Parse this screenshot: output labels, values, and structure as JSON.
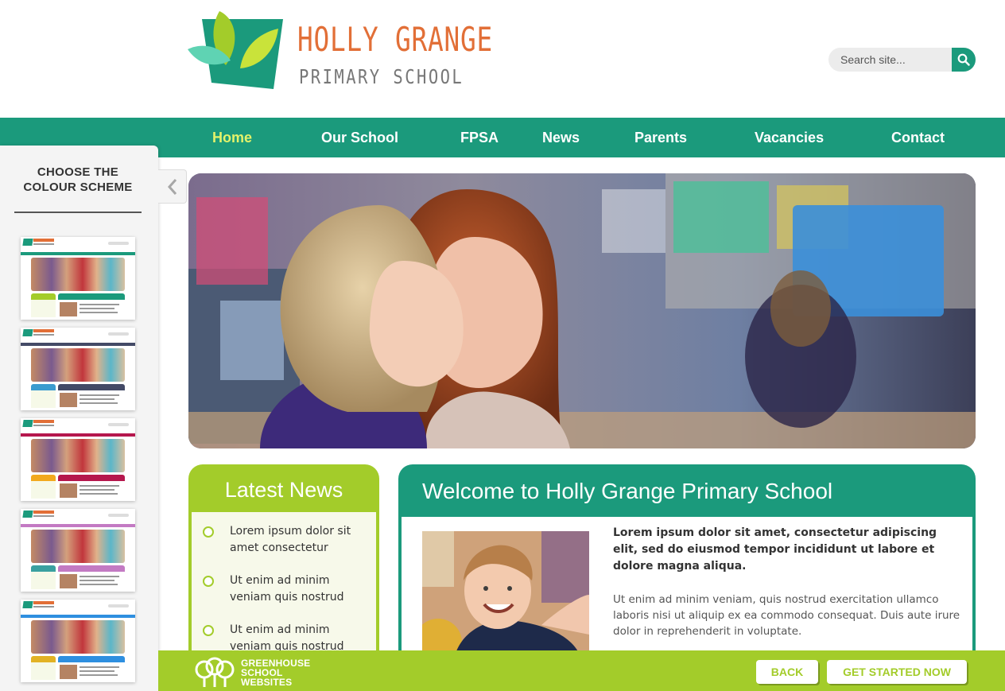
{
  "header": {
    "school_name": "HOLLY GRANGE",
    "school_type": "PRIMARY SCHOOL",
    "search": {
      "placeholder": "Search site...",
      "value": ""
    }
  },
  "nav": {
    "items": [
      {
        "label": "Home",
        "active": true
      },
      {
        "label": "Our School",
        "active": false
      },
      {
        "label": "FPSA",
        "active": false
      },
      {
        "label": "News",
        "active": false
      },
      {
        "label": "Parents",
        "active": false
      },
      {
        "label": "Vacancies",
        "active": false
      },
      {
        "label": "Contact",
        "active": false
      }
    ]
  },
  "side_panel": {
    "title": "CHOOSE THE COLOUR SCHEME",
    "schemes": [
      {
        "primary": "#1b9a7c",
        "secondary": "#a3cc2a"
      },
      {
        "primary": "#434a66",
        "secondary": "#3b9bcf"
      },
      {
        "primary": "#b5174d",
        "secondary": "#f2a91e"
      },
      {
        "primary": "#c37ac3",
        "secondary": "#3aa0a0"
      },
      {
        "primary": "#2e8fe0",
        "secondary": "#e2b224"
      }
    ]
  },
  "latest_news": {
    "title": "Latest News",
    "items": [
      {
        "text": "Lorem ipsum dolor sit amet consectetur"
      },
      {
        "text": "Ut enim ad minim veniam quis nostrud"
      },
      {
        "text": "Ut enim ad minim veniam quis nostrud"
      }
    ]
  },
  "welcome": {
    "title": "Welcome to Holly Grange Primary School",
    "lead": "Lorem ipsum dolor sit amet, consectetur adipiscing elit, sed do eiusmod tempor incididunt ut labore et dolore magna aliqua.",
    "paragraph": "Ut enim ad minim veniam, quis nostrud exercitation ullamco laboris nisi ut aliquip ex ea commodo consequat. Duis aute irure dolor in reprehenderit in voluptate."
  },
  "bottom_bar": {
    "brand": [
      "GREENHOUSE",
      "SCHOOL",
      "WEBSITES"
    ],
    "back_label": "BACK",
    "start_label": "GET STARTED NOW"
  },
  "colors": {
    "primary": "#1b9a7c",
    "accent": "#a3cc2a",
    "logo_orange": "#e26f37",
    "nav_active": "#e3f26a"
  },
  "icons": {
    "search": "search-icon",
    "collapse": "chevron-left-icon",
    "news_bullet": "circle-bullet-icon",
    "brand": "greenhouse-tree-icon"
  }
}
